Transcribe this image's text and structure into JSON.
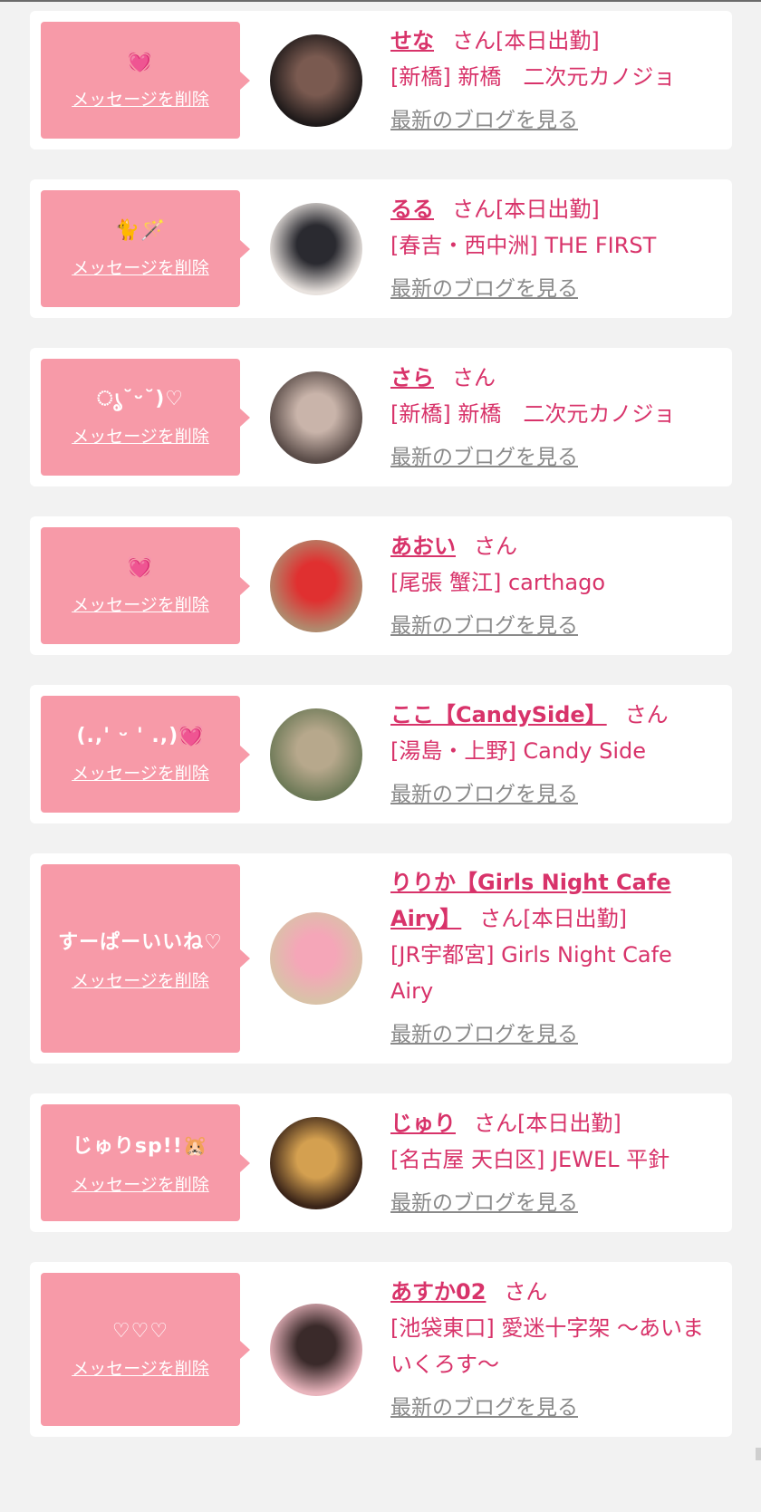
{
  "delete_label": "メッセージを削除",
  "blog_label": "最新のブログを見る",
  "cards": [
    {
      "message": "💓",
      "name": "せな",
      "suffix": "さん[本日出勤]",
      "shop": "[新橋] 新橋　二次元カノジョ",
      "avatar_colors": [
        "#1f1a1a",
        "#7a5a50"
      ]
    },
    {
      "message": "🐈🪄",
      "name": "るる",
      "suffix": "さん[本日出勤]",
      "shop": "[春吉・西中洲] THE FIRST",
      "avatar_colors": [
        "#e8e2de",
        "#2a2a30"
      ]
    },
    {
      "message": "ൃ˘ᵕ˘)♡",
      "name": "さら",
      "suffix": "さん",
      "shop": "[新橋] 新橋　二次元カノジョ",
      "avatar_colors": [
        "#5a4c48",
        "#c9b4aa"
      ]
    },
    {
      "message": "💓",
      "name": "あおい",
      "suffix": "さん",
      "shop": "[尾張 蟹江] carthago",
      "avatar_colors": [
        "#b08a6e",
        "#e03030"
      ]
    },
    {
      "message": "(.,' ᵕ ' .,)💓",
      "name": "ここ【CandySide】",
      "suffix": "さん",
      "shop": "[湯島・上野] Candy Side",
      "avatar_colors": [
        "#6e7a58",
        "#b7a88c"
      ]
    },
    {
      "message": "すーぱーいいね♡",
      "name": "りりか【Girls Night Cafe Airy】",
      "suffix": "さん[本日出勤]",
      "shop": "[JR宇都宮] Girls Night Cafe Airy",
      "avatar_colors": [
        "#d9c2a8",
        "#f5a6b8"
      ]
    },
    {
      "message": "じゅりsp!!🐹",
      "name": "じゅり",
      "suffix": "さん[本日出勤]",
      "shop": "[名古屋 天白区] JEWEL 平針",
      "avatar_colors": [
        "#3a2418",
        "#d4a050"
      ]
    },
    {
      "message": "♡♡♡",
      "name": "あすか02",
      "suffix": "さん",
      "shop": "[池袋東口] 愛迷十字架 〜あいまいくろす〜",
      "avatar_colors": [
        "#e8b4bc",
        "#3a2a2a"
      ]
    }
  ]
}
